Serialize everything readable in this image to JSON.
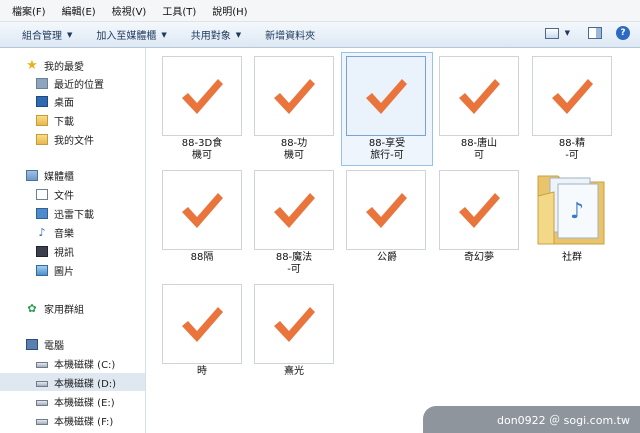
{
  "menu": [
    "檔案(F)",
    "編輯(E)",
    "檢視(V)",
    "工具(T)",
    "說明(H)"
  ],
  "toolbar": {
    "buttons": [
      {
        "label": "組合管理",
        "caret": "▼"
      },
      {
        "label": "加入至媒體櫃",
        "caret": "▼"
      },
      {
        "label": "共用對象",
        "caret": "▼"
      },
      {
        "label": "新增資料夾",
        "caret": ""
      }
    ],
    "view_caret": "▼",
    "help": "?"
  },
  "nav": [
    {
      "label": "我的最愛",
      "icon": "star-icon"
    },
    {
      "label": "最近的位置",
      "icon": "recent-places-icon"
    },
    {
      "label": "桌面",
      "icon": "desktop-icon"
    },
    {
      "label": "下載",
      "icon": "downloads-folder-icon"
    },
    {
      "label": "我的文件",
      "icon": "documents-folder-icon"
    },
    {
      "label": "媒體櫃",
      "icon": "libraries-icon"
    },
    {
      "label": "文件",
      "icon": "document-icon"
    },
    {
      "label": "迅雷下載",
      "icon": "download-icon"
    },
    {
      "label": "音樂",
      "icon": "music-icon"
    },
    {
      "label": "視訊",
      "icon": "video-icon"
    },
    {
      "label": "圖片",
      "icon": "pictures-icon"
    },
    {
      "label": "家用群組",
      "icon": "homegroup-icon"
    },
    {
      "label": "電腦",
      "icon": "computer-icon"
    },
    {
      "label": "本機磁碟 (C:)",
      "icon": "drive-icon"
    },
    {
      "label": "本機磁碟 (D:)",
      "icon": "drive-icon",
      "selected": true
    },
    {
      "label": "本機磁碟 (E:)",
      "icon": "drive-icon"
    },
    {
      "label": "本機磁碟 (F:)",
      "icon": "drive-icon"
    }
  ],
  "files": [
    {
      "line1": "88-3D食",
      "line2": "機可",
      "icon": "checkmark-icon"
    },
    {
      "line1": "88-功",
      "line2": "機可",
      "icon": "checkmark-icon"
    },
    {
      "line1": "88-享受",
      "line2": "旅行-可",
      "icon": "checkmark-icon",
      "selected": true
    },
    {
      "line1": "88-唐山",
      "line2": "可",
      "icon": "checkmark-icon"
    },
    {
      "line1": "88-精",
      "line2": "-可",
      "icon": "checkmark-icon"
    },
    {
      "line1": "88隔",
      "line2": "",
      "icon": "checkmark-icon"
    },
    {
      "line1": "88-魔法",
      "line2": "-可",
      "icon": "checkmark-icon"
    },
    {
      "line1": "公爵",
      "line2": "",
      "icon": "checkmark-icon"
    },
    {
      "line1": "奇幻夢",
      "line2": "",
      "icon": "checkmark-icon"
    },
    {
      "line1": "社群",
      "line2": "",
      "icon": "music-folder-icon"
    },
    {
      "line1": "時",
      "line2": "",
      "icon": "checkmark-icon"
    },
    {
      "line1": "熹光",
      "line2": "",
      "icon": "checkmark-icon"
    }
  ],
  "watermark": "don0922 ＠ sogi.com.tw",
  "colors": {
    "check": "#e9743c",
    "check_light": "#f3a172",
    "selection": "#eef5fc"
  }
}
